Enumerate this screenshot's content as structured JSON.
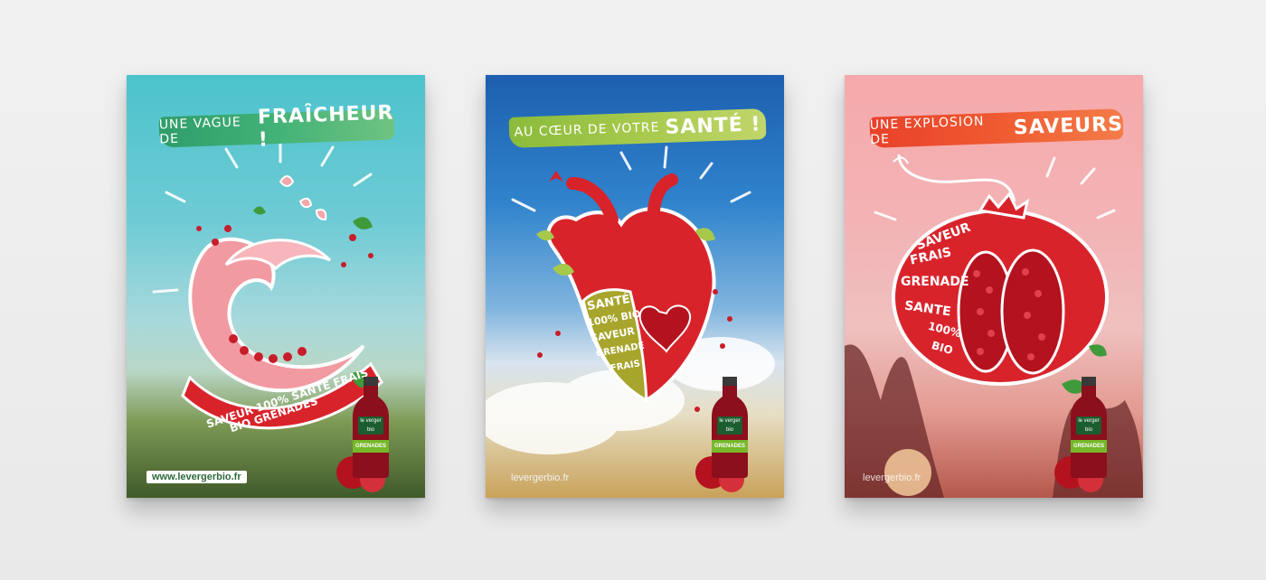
{
  "posters": [
    {
      "banner_small": "UNE VAGUE DE",
      "banner_big": "FRAÎCHEUR !",
      "art_words": [
        "SAVEUR 100% SANTE FRAIS",
        "BIO GRENADES"
      ],
      "bottle_brand": "le verger bio",
      "bottle_label": "GRENADES",
      "url": "www.levergerbio.fr"
    },
    {
      "banner_small": "AU CŒUR DE VOTRE",
      "banner_big": "SANTÉ !",
      "art_words": [
        "SANTÉ",
        "100% BIO",
        "SAVEUR",
        "GRENADE",
        "FRAIS"
      ],
      "bottle_brand": "le verger bio",
      "bottle_label": "GRENADES",
      "url": "levergerbio.fr"
    },
    {
      "banner_small": "UNE EXPLOSION DE",
      "banner_big": "SAVEURS",
      "art_words": [
        "SAVEUR",
        "FRAIS",
        "GRENADE",
        "SANTE",
        "100%",
        "BIO"
      ],
      "bottle_brand": "le verger bio",
      "bottle_label": "GRENADES",
      "url": "levergerbio.fr"
    }
  ],
  "colors": {
    "pomegranate_red": "#d9232b",
    "leaf_green": "#3f9a3a",
    "banner_green": "#43b277",
    "banner_lime": "#a6c94c",
    "banner_orange": "#ef5a31"
  }
}
